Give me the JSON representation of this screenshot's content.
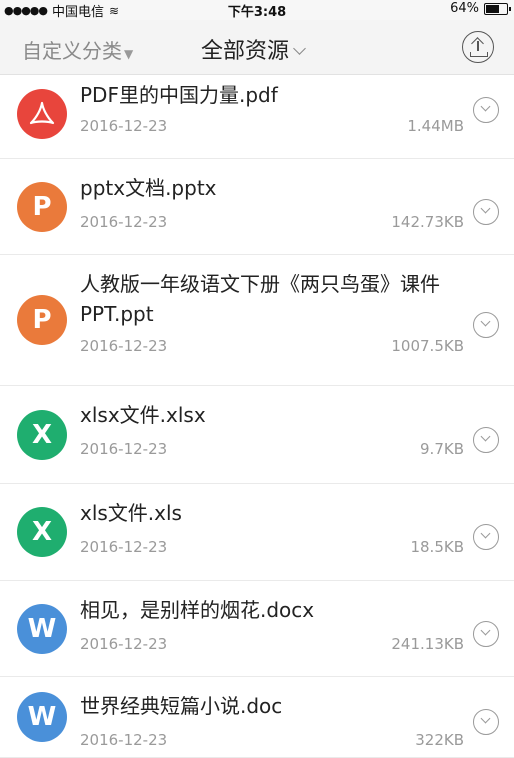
{
  "status_bar": {
    "signal": "●●●●●",
    "carrier": "中国电信",
    "time": "下午3:48",
    "battery": "64%",
    "battery_level": 0.64
  },
  "nav": {
    "custom_category": "自定义分类",
    "title": "全部资源"
  },
  "files": [
    {
      "type": "pdf",
      "icon_letter": "",
      "color": "#e8453c",
      "name": "PDF里的中国力量.pdf",
      "date": "2016-12-23",
      "size": "1.44MB"
    },
    {
      "type": "ppt",
      "icon_letter": "P",
      "color": "#ea7a3b",
      "name": "pptx文档.pptx",
      "date": "2016-12-23",
      "size": "142.73KB"
    },
    {
      "type": "ppt",
      "icon_letter": "P",
      "color": "#ea7a3b",
      "name": "人教版一年级语文下册《两只鸟蛋》课件PPT.ppt",
      "date": "2016-12-23",
      "size": "1007.5KB"
    },
    {
      "type": "xls",
      "icon_letter": "X",
      "color": "#1fae6f",
      "name": "xlsx文件.xlsx",
      "date": "2016-12-23",
      "size": "9.7KB"
    },
    {
      "type": "xls",
      "icon_letter": "X",
      "color": "#1fae6f",
      "name": "xls文件.xls",
      "date": "2016-12-23",
      "size": "18.5KB"
    },
    {
      "type": "doc",
      "icon_letter": "W",
      "color": "#4a90d9",
      "name": "相见，是别样的烟花.docx",
      "date": "2016-12-23",
      "size": "241.13KB"
    },
    {
      "type": "doc",
      "icon_letter": "W",
      "color": "#4a90d9",
      "name": "世界经典短篇小说.doc",
      "date": "2016-12-23",
      "size": "322KB"
    }
  ]
}
